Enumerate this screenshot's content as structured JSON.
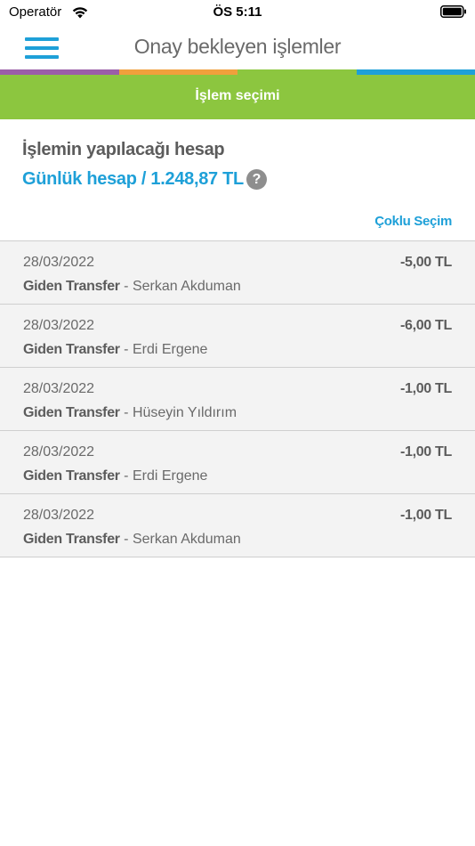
{
  "status_bar": {
    "carrier": "Operatör",
    "time": "ÖS 5:11",
    "wifi_icon": "wifi-icon",
    "battery_icon": "battery-icon"
  },
  "header": {
    "title": "Onay bekleyen işlemler",
    "menu_icon": "hamburger-menu-icon"
  },
  "color_strip": [
    "#9b5ea8",
    "#f0a03c",
    "#8cc63f",
    "#1ea0d8"
  ],
  "segment": {
    "label": "İşlem seçimi",
    "color": "#8cc63f"
  },
  "account": {
    "heading": "İşlemin yapılacağı hesap",
    "value": "Günlük hesap / 1.248,87 TL",
    "help_icon": "?",
    "multi_select_label": "Çoklu Seçim"
  },
  "transactions": [
    {
      "date": "28/03/2022",
      "amount": "-5,00 TL",
      "type": "Giden Transfer",
      "separator": " - ",
      "name": "Serkan Akduman"
    },
    {
      "date": "28/03/2022",
      "amount": "-6,00 TL",
      "type": "Giden Transfer",
      "separator": " - ",
      "name": "Erdi Ergene"
    },
    {
      "date": "28/03/2022",
      "amount": "-1,00 TL",
      "type": "Giden Transfer",
      "separator": " - ",
      "name": "Hüseyin Yıldırım"
    },
    {
      "date": "28/03/2022",
      "amount": "-1,00 TL",
      "type": "Giden Transfer",
      "separator": " - ",
      "name": "Erdi Ergene"
    },
    {
      "date": "28/03/2022",
      "amount": "-1,00 TL",
      "type": "Giden Transfer",
      "separator": " - ",
      "name": "Serkan Akduman"
    }
  ],
  "colors": {
    "accent_blue": "#1ea0d8",
    "accent_green": "#8cc63f",
    "row_background": "#f3f3f3"
  }
}
